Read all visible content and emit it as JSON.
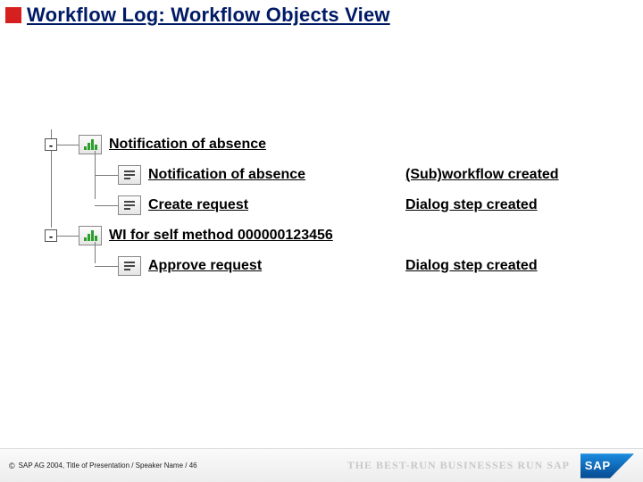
{
  "title": "Workflow Log: Workflow Objects View",
  "tree": {
    "nodes": [
      {
        "id": "n1",
        "label": "Notification of absence",
        "status": "",
        "icon": "chart",
        "expander": "-",
        "children": [
          {
            "id": "n1a",
            "label": "Notification of absence",
            "status": "(Sub)workflow created",
            "icon": "doc"
          },
          {
            "id": "n1b",
            "label": "Create request",
            "status": "Dialog step created",
            "icon": "doc"
          }
        ]
      },
      {
        "id": "n2",
        "label": "WI for self method 000000123456",
        "status": "",
        "icon": "chart",
        "expander": "-",
        "children": [
          {
            "id": "n2a",
            "label": "Approve request",
            "status": "Dialog step created",
            "icon": "doc"
          }
        ]
      }
    ]
  },
  "footer": {
    "copyright": "SAP AG 2004, Title of Presentation / Speaker Name / 46",
    "tagline": "THE BEST-RUN BUSINESSES RUN SAP"
  }
}
